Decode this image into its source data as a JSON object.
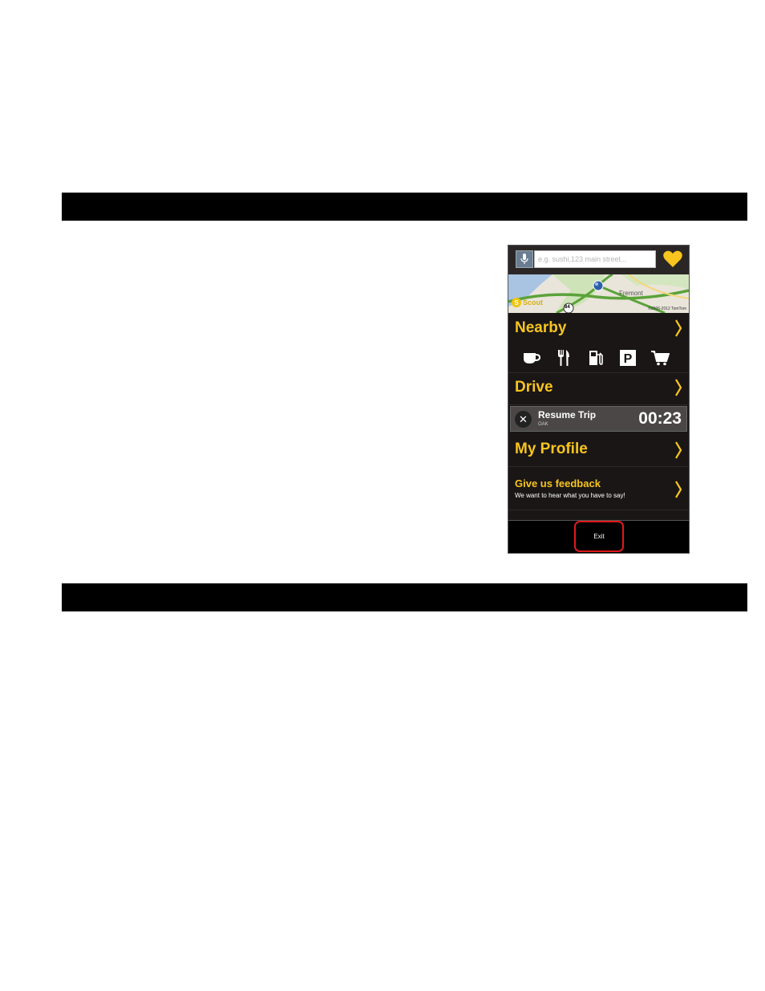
{
  "app": {
    "search": {
      "placeholder": "e.g. sushi,123 main street..."
    },
    "map": {
      "city": "Fremont",
      "route_shield": "84",
      "brand": "Scout",
      "credit": "©2006-2012 TomTom"
    },
    "nearby": {
      "title": "Nearby",
      "categories": [
        "coffee-icon",
        "restaurant-icon",
        "gas-station-icon",
        "parking-icon",
        "grocery-icon"
      ]
    },
    "drive": {
      "title": "Drive"
    },
    "resume_trip": {
      "label": "Resume Trip",
      "destination": "OAK",
      "time": "00:23"
    },
    "profile": {
      "title": "My Profile"
    },
    "feedback": {
      "title": "Give us feedback",
      "description": "We want to hear what you have to say!"
    },
    "footer": {
      "exit_label": "Exit"
    }
  },
  "colors": {
    "accent": "#f7c51d",
    "highlight": "#e01919",
    "background": "#1a1616"
  }
}
